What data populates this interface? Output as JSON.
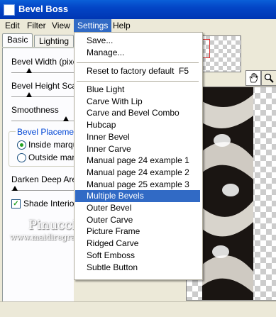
{
  "window": {
    "title": "Bevel Boss"
  },
  "menubar": {
    "items": [
      "Edit",
      "Filter",
      "View",
      "Settings",
      "Help"
    ]
  },
  "tabs": [
    "Basic",
    "Lighting"
  ],
  "panel": {
    "bevel_width": "Bevel Width (pixel",
    "bevel_height": "Bevel Height Scal",
    "smoothness": "Smoothness",
    "bevel_placement": "Bevel Placemen",
    "inside": "Inside marqu",
    "outside": "Outside marqu",
    "darken": "Darken Deep Area",
    "shade_interior": "Shade Interior"
  },
  "settings_menu": {
    "top": [
      {
        "label": "Save...",
        "shortcut": ""
      },
      {
        "label": "Manage...",
        "shortcut": ""
      }
    ],
    "reset": {
      "label": "Reset to factory default",
      "shortcut": "F5"
    },
    "presets": [
      "Blue Light",
      "Carve With Lip",
      "Carve and Bevel Combo",
      "Hubcap",
      "Inner Bevel",
      "Inner Carve",
      "Manual page 24 example 1",
      "Manual page 24 example 2",
      "Manual page 25 example 3",
      "Multiple Bevels",
      "Outer Bevel",
      "Outer Carve",
      "Picture Frame",
      "Ridged Carve",
      "Soft Emboss",
      "Subtle Button"
    ],
    "highlighted": "Multiple Bevels"
  },
  "watermark": {
    "name": "Pinuccia",
    "url": "www.maidiregrafica.eu"
  },
  "icons": [
    "hand-icon",
    "zoom-icon"
  ]
}
